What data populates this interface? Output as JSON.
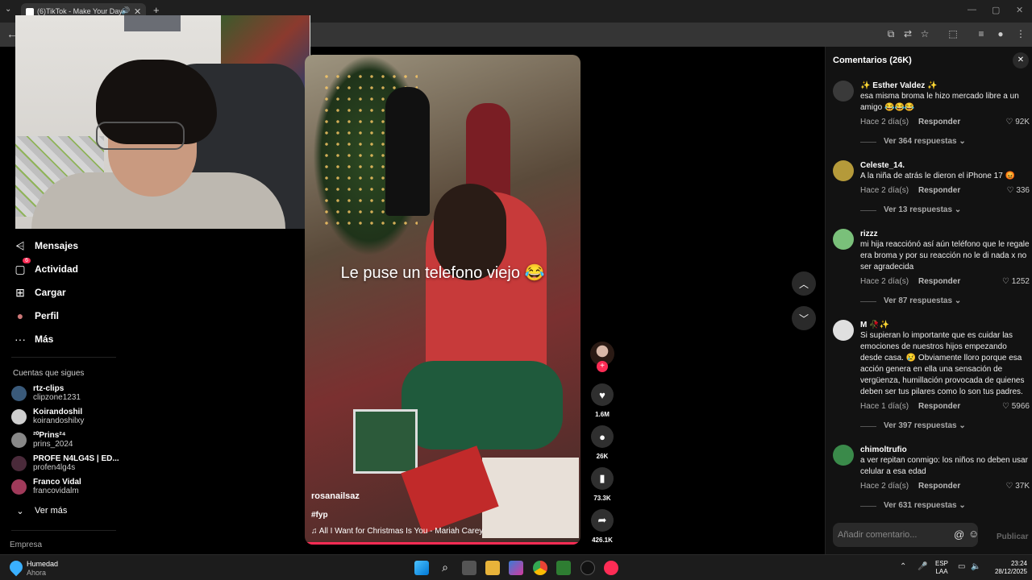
{
  "browser": {
    "tab_title": "(6)TikTok - Make Your Day",
    "tab_close": "✕",
    "new_tab": "+",
    "back": "←"
  },
  "sidebar": {
    "nav": [
      {
        "icon": "send-icon",
        "glyph": "⩤",
        "label": "Mensajes"
      },
      {
        "icon": "activity-icon",
        "glyph": "▢",
        "label": "Actividad",
        "badge": "6"
      },
      {
        "icon": "upload-icon",
        "glyph": "⊞",
        "label": "Cargar"
      },
      {
        "icon": "profile-icon",
        "glyph": "●",
        "label": "Perfil"
      },
      {
        "icon": "more-icon",
        "glyph": "···",
        "label": "Más"
      }
    ],
    "following_title": "Cuentas que sigues",
    "following": [
      {
        "name": "rtz-clips",
        "user": "clipzone1231"
      },
      {
        "name": "Koirandoshil",
        "user": "koirandoshilxy"
      },
      {
        "name": "²⁰Prins²⁴",
        "user": "prins_2024"
      },
      {
        "name": "PROFE N4LG4S | ED...",
        "user": "profen4lg4s"
      },
      {
        "name": "Franco Vidal",
        "user": "francovidalm"
      }
    ],
    "see_more": "Ver más",
    "company": "Empresa"
  },
  "video": {
    "caption": "Le puse un telefono viejo 😂",
    "author": "rosanailsaz",
    "hashtag": "#fyp",
    "music": "♫  All I Want for Christmas Is You - Mariah Carey"
  },
  "actions": {
    "likes": "1.6M",
    "comments": "26K",
    "saves": "73.3K",
    "shares": "426.1K"
  },
  "comments_panel": {
    "title": "Comentarios (26K)",
    "reply_label": "Responder",
    "items": [
      {
        "user": "✨ Esther Valdez ✨",
        "text": "esa misma broma le hizo mercado libre a un amigo 😂😂😂",
        "date": "Hace 2 día(s)",
        "likes": "92K",
        "replies": "Ver 364 respuestas ⌄"
      },
      {
        "user": "Celeste_14.",
        "text": "A la niña de atrás le dieron el iPhone 17 😡",
        "date": "Hace 2 día(s)",
        "likes": "336",
        "replies": "Ver 13 respuestas ⌄"
      },
      {
        "user": "rizzz",
        "text": "mi hija reacciónó así aún teléfono que le regale era broma y por su reacción no le di nada x no ser agradecida",
        "date": "Hace 2 día(s)",
        "likes": "1252",
        "replies": "Ver 87 respuestas ⌄"
      },
      {
        "user": "M 🥀✨",
        "text": "Si supieran lo importante que es cuidar las emociones de nuestros hijos empezando desde casa. 😢 Obviamente lloro porque esa acción genera en ella una sensación de vergüenza, humillación provocada de quienes deben ser tus pilares como lo son tus padres.",
        "date": "Hace 1 día(s)",
        "likes": "5966",
        "replies": "Ver 397 respuestas ⌄"
      },
      {
        "user": "chimoltrufio",
        "text": "a ver repitan conmigo: los niños no deben usar celular a esa edad",
        "date": "Hace 2 día(s)",
        "likes": "37K",
        "replies": "Ver 631 respuestas ⌄"
      }
    ],
    "input_placeholder": "Añadir comentario...",
    "publish": "Publicar"
  },
  "taskbar": {
    "weather_title": "Humedad",
    "weather_sub": "Ahora",
    "lang1": "ESP",
    "lang2": "LAA",
    "time": "23:24",
    "date": "28/12/2025"
  },
  "colors": {
    "accent": "#fe2c55",
    "panel": "#121212"
  }
}
